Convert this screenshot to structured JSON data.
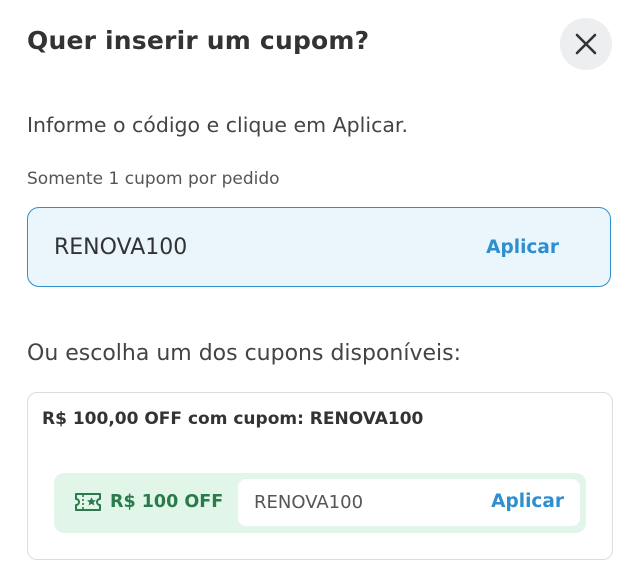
{
  "header": {
    "title": "Quer inserir um cupom?",
    "close_icon": "close-icon"
  },
  "form": {
    "instruction": "Informe o código e clique em Aplicar.",
    "limit_note": "Somente 1 cupom por pedido",
    "code_value": "RENOVA100",
    "apply_label": "Aplicar"
  },
  "available": {
    "heading": "Ou escolha um dos cupons disponíveis:",
    "coupons": [
      {
        "title": "R$ 100,00 OFF com cupom: RENOVA100",
        "badge_icon": "ticket-star-icon",
        "badge_label": "R$ 100 OFF",
        "code": "RENOVA100",
        "apply_label": "Aplicar"
      }
    ]
  },
  "colors": {
    "accent_blue": "#2d8fd0",
    "input_background": "#eaf5fc",
    "coupon_green": "#2b7a4c",
    "coupon_green_background": "#e1f6e8",
    "text_dark": "#333333"
  }
}
